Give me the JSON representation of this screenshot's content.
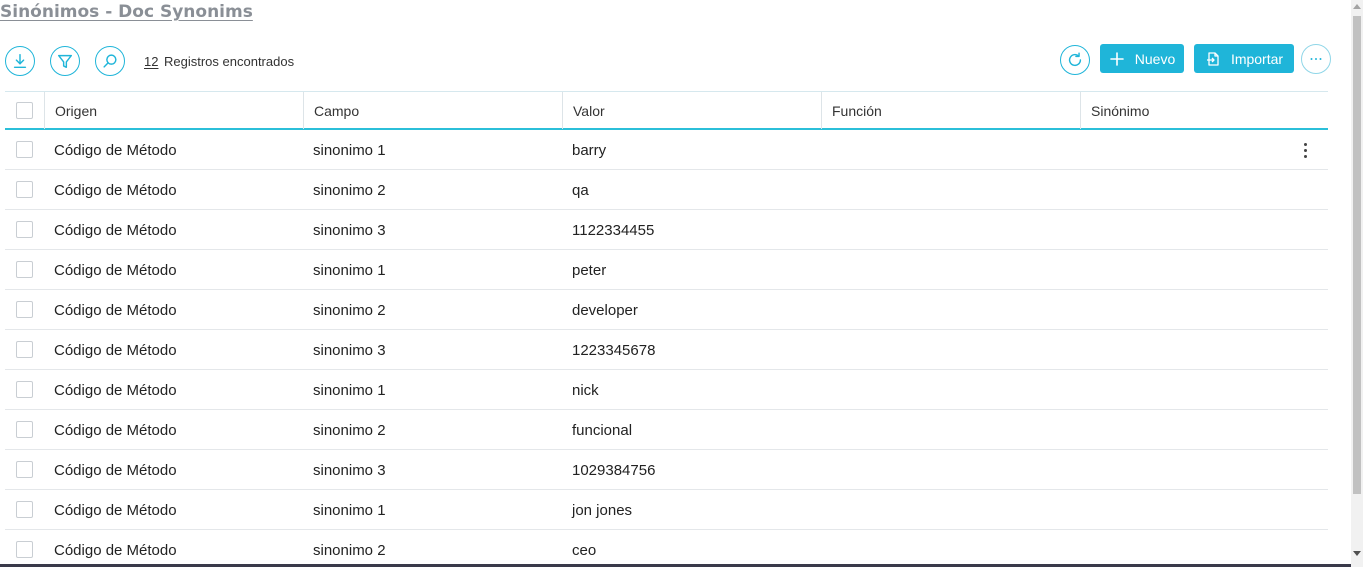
{
  "page": {
    "title": "Sinónimos - Doc Synonims"
  },
  "toolbar": {
    "record_count": "12",
    "record_label": "Registros encontrados",
    "new_label": "Nuevo",
    "import_label": "Importar",
    "icons": [
      "download-icon",
      "filter-icon",
      "search-icon",
      "refresh-icon",
      "plus-icon",
      "import-icon",
      "more-icon"
    ]
  },
  "colors": {
    "accent": "#1fb5d9",
    "title": "#8a8f96"
  },
  "table": {
    "columns": [
      "Origen",
      "Campo",
      "Valor",
      "Función",
      "Sinónimo"
    ],
    "rows": [
      {
        "origen": "Código de Método",
        "campo": "sinonimo 1",
        "valor": "barry",
        "funcion": "",
        "sinonimo": ""
      },
      {
        "origen": "Código de Método",
        "campo": "sinonimo 2",
        "valor": "qa",
        "funcion": "",
        "sinonimo": ""
      },
      {
        "origen": "Código de Método",
        "campo": "sinonimo 3",
        "valor": "1122334455",
        "funcion": "",
        "sinonimo": ""
      },
      {
        "origen": "Código de Método",
        "campo": "sinonimo 1",
        "valor": "peter",
        "funcion": "",
        "sinonimo": ""
      },
      {
        "origen": "Código de Método",
        "campo": "sinonimo 2",
        "valor": "developer",
        "funcion": "",
        "sinonimo": ""
      },
      {
        "origen": "Código de Método",
        "campo": "sinonimo 3",
        "valor": "1223345678",
        "funcion": "",
        "sinonimo": ""
      },
      {
        "origen": "Código de Método",
        "campo": "sinonimo 1",
        "valor": "nick",
        "funcion": "",
        "sinonimo": ""
      },
      {
        "origen": "Código de Método",
        "campo": "sinonimo 2",
        "valor": "funcional",
        "funcion": "",
        "sinonimo": ""
      },
      {
        "origen": "Código de Método",
        "campo": "sinonimo 3",
        "valor": "1029384756",
        "funcion": "",
        "sinonimo": ""
      },
      {
        "origen": "Código de Método",
        "campo": "sinonimo 1",
        "valor": "jon jones",
        "funcion": "",
        "sinonimo": ""
      },
      {
        "origen": "Código de Método",
        "campo": "sinonimo 2",
        "valor": "ceo",
        "funcion": "",
        "sinonimo": ""
      }
    ]
  }
}
